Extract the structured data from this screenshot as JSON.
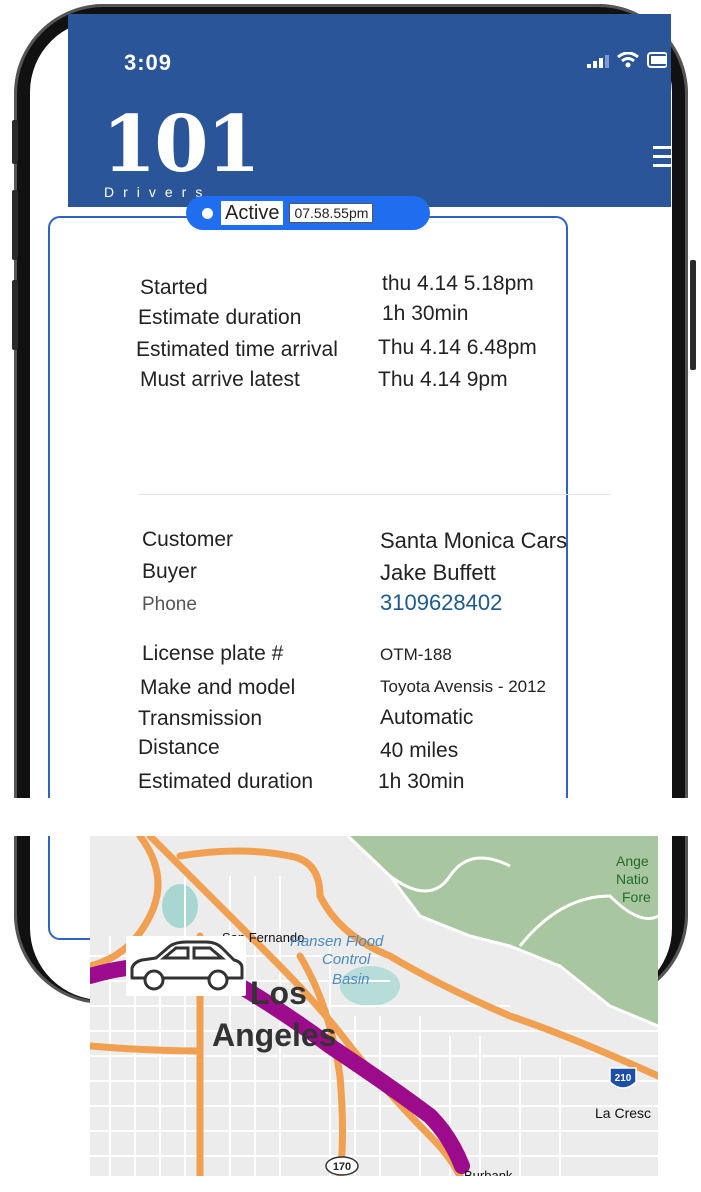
{
  "status_bar": {
    "time": "3:09"
  },
  "header": {
    "logo_main": "101",
    "logo_sub": "Drivers"
  },
  "trip_status": {
    "label": "Active",
    "time": "07.58.55pm"
  },
  "schedule": [
    {
      "label": "Started",
      "value": "thu 4.14  5.18pm"
    },
    {
      "label": "Estimate duration",
      "value": "1h 30min"
    },
    {
      "label": "Estimated time arrival",
      "value": "Thu 4.14  6.48pm"
    },
    {
      "label": "Must arrive latest",
      "value": "Thu 4.14  9pm"
    }
  ],
  "contact": [
    {
      "label": "Customer",
      "value": "Santa Monica Cars"
    },
    {
      "label": "Buyer",
      "value": "Jake Buffett"
    },
    {
      "label": "Phone",
      "value": "3109628402"
    }
  ],
  "vehicle": [
    {
      "label": "License plate #",
      "value": "OTM-188"
    },
    {
      "label": "Make and model",
      "value": "Toyota Avensis - 2012"
    },
    {
      "label": "Transmission",
      "value": "Automatic"
    },
    {
      "label": "Distance",
      "value": "40 miles"
    },
    {
      "label": "Estimated duration",
      "value": "1h 30min"
    }
  ],
  "map": {
    "labels": {
      "san_fernando": "San Fernando",
      "hansen": "Hansen Flood",
      "control": "Control",
      "basin": "Basin",
      "los": "Los",
      "angeles": "Angeles",
      "forest_1": "Ange",
      "forest_2": "Natio",
      "forest_3": "Fore",
      "la_cresc": "La Cresc",
      "burbank": "Burbank",
      "hwy_210": "210",
      "hwy_170": "170"
    },
    "route_color": "#9c0b8c",
    "highway_color": "#f0a050",
    "forest_color": "#a8c6a0"
  },
  "colors": {
    "header_bg": "#2a5598",
    "accent": "#1f6ef0",
    "card_border": "#2f64c4"
  }
}
